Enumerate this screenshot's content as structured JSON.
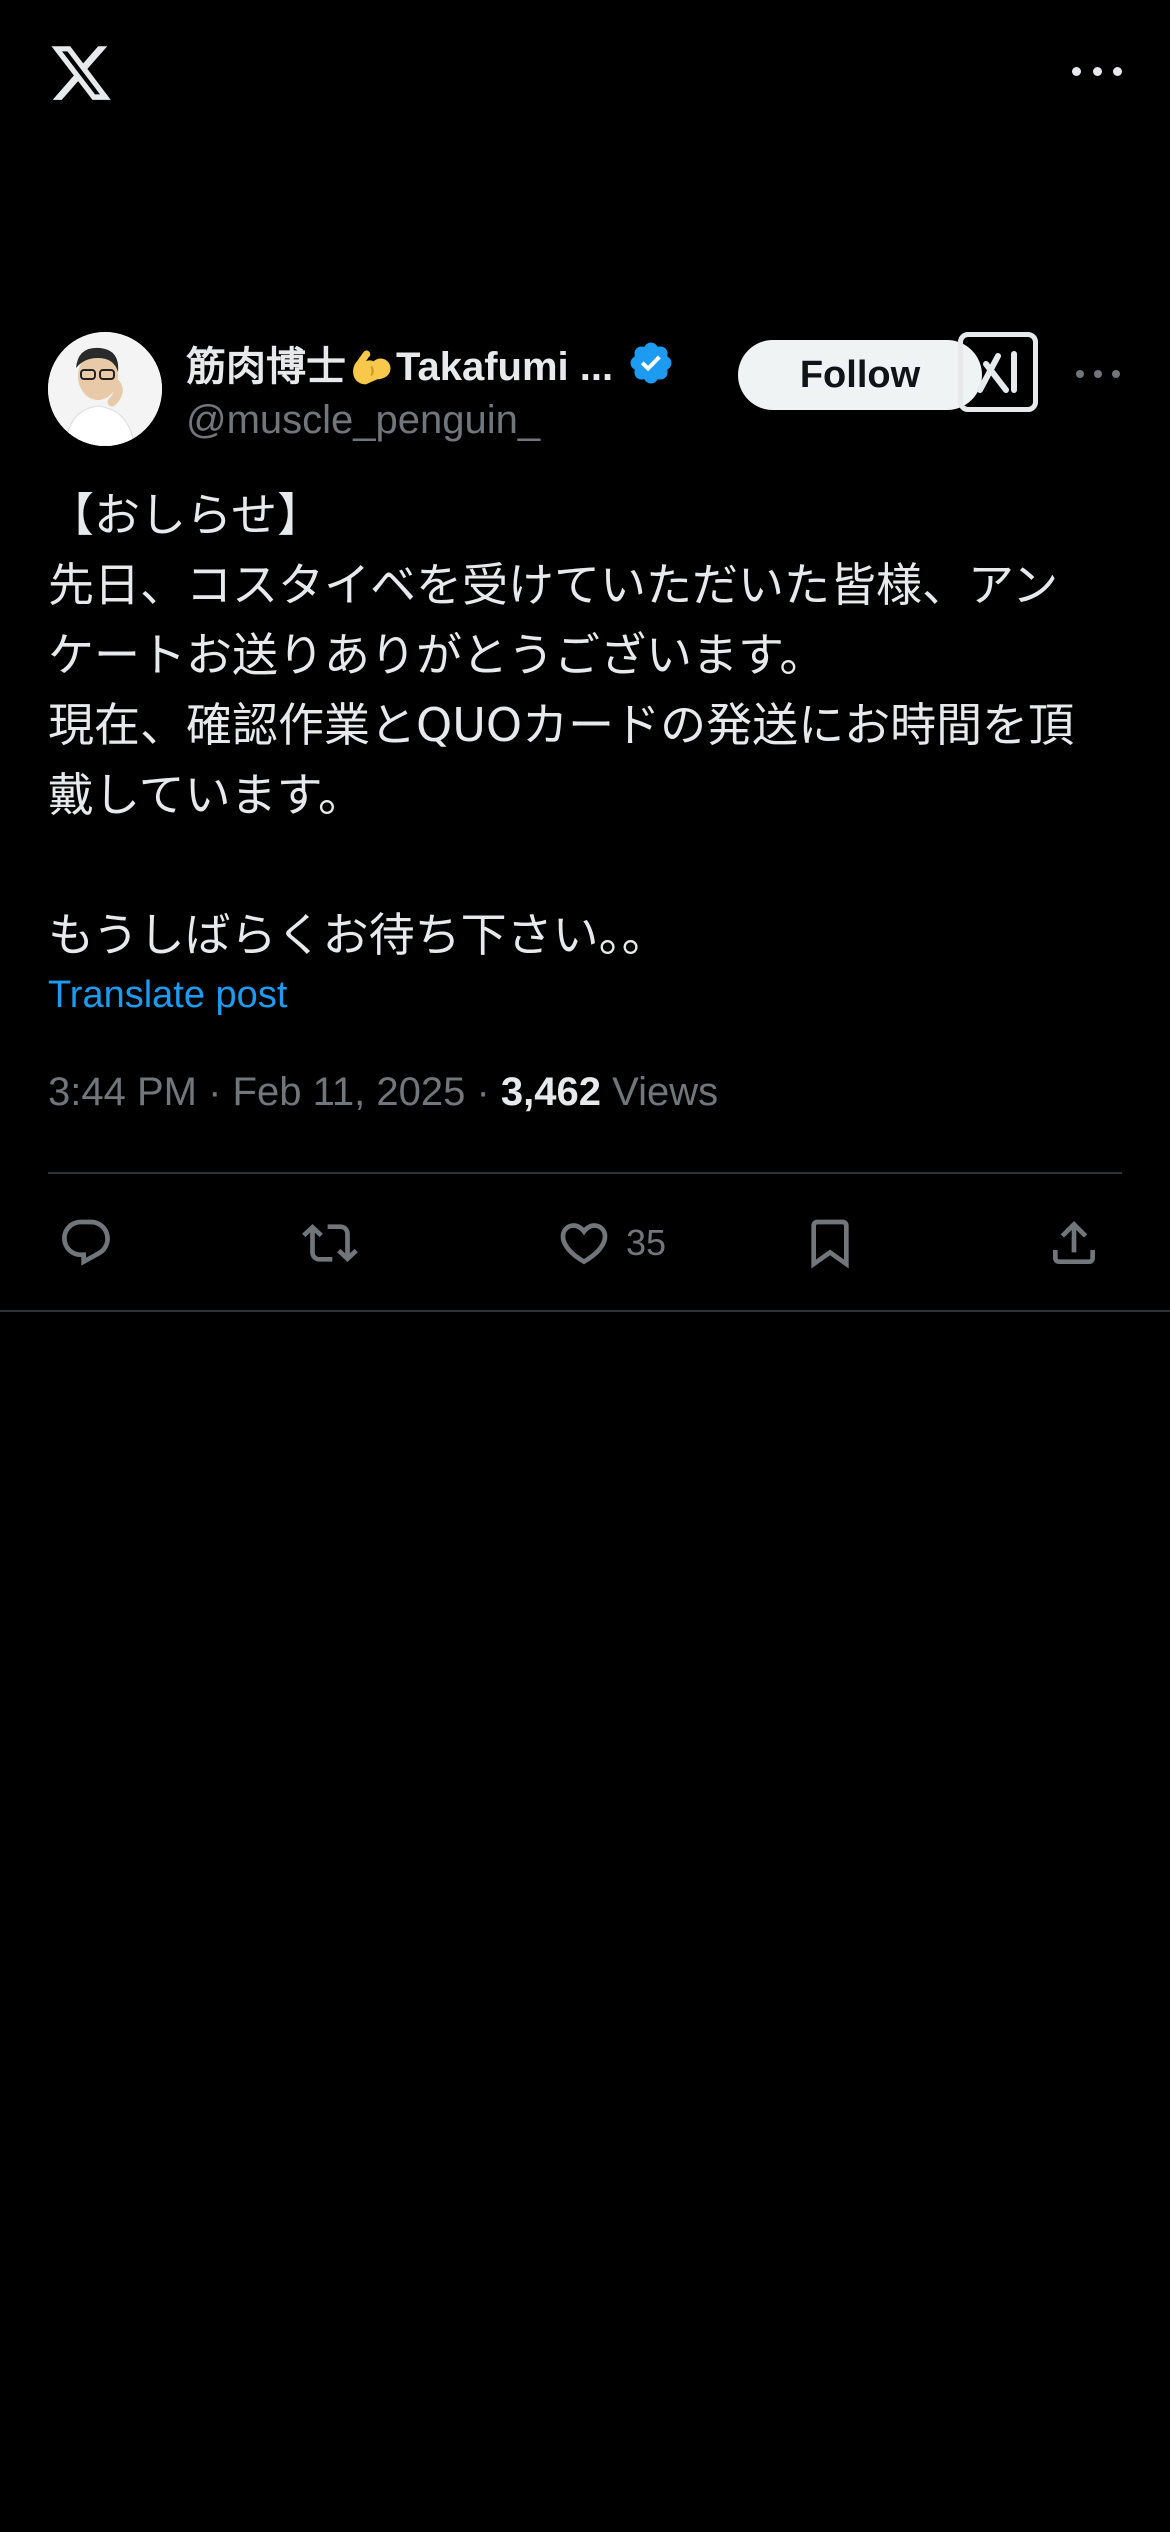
{
  "topbar": {
    "logo_icon": "x-logo-icon",
    "more_icon": "more-horizontal-icon"
  },
  "author": {
    "display_name_part1": "筋肉博士",
    "display_name_emoji_icon": "flexed-biceps-icon",
    "display_name_part2": "Takafumi ...",
    "verified_icon": "verified-badge-icon",
    "handle": "@muscle_penguin_",
    "follow_label": "Follow",
    "grok_icon": "grok-icon",
    "more_icon": "more-horizontal-icon"
  },
  "post": {
    "text": "【おしらせ】\n先日、コスタイベを受けていただいた皆様、アン\nケートお送りありがとうございます。\n現在、確認作業とQUOカードの発送にお時間を頂\n戴しています。\n\nもうしばらくお待ち下さい。。",
    "translate_label": "Translate post",
    "time": "3:44 PM",
    "separator": "·",
    "date": "Feb 11, 2025",
    "views_count": "3,462",
    "views_label": "Views"
  },
  "actions": {
    "reply_icon": "reply-icon",
    "repost_icon": "repost-icon",
    "like_icon": "heart-icon",
    "like_count": "35",
    "bookmark_icon": "bookmark-icon",
    "share_icon": "share-icon"
  },
  "colors": {
    "background": "#000000",
    "text": "#e7e9ea",
    "secondary_text": "#71767b",
    "link": "#1d9bf0",
    "verified": "#1d9bf0",
    "divider": "#2f3336"
  }
}
